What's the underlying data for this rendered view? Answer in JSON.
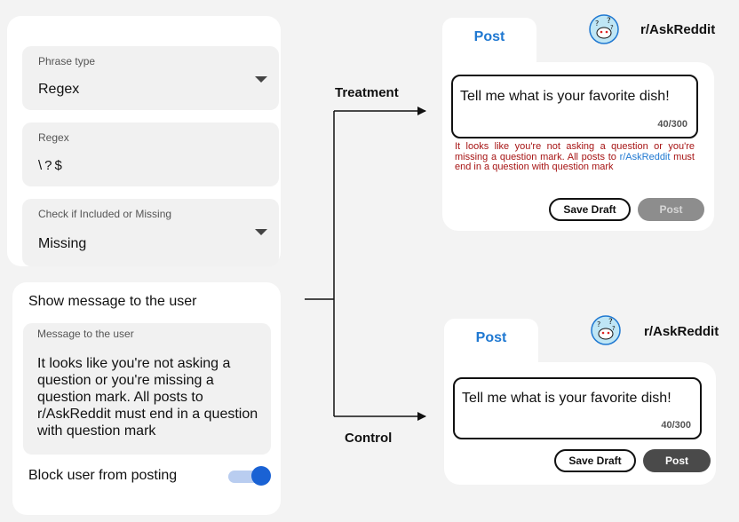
{
  "form": {
    "phrase_type": {
      "label": "Phrase type",
      "value": "Regex"
    },
    "regex": {
      "label": "Regex",
      "value": "\\?$"
    },
    "check": {
      "label": "Check if Included or Missing",
      "value": "Missing"
    }
  },
  "message_settings": {
    "show_label": "Show message to the user",
    "message_field_label": "Message to the user",
    "message": "It looks like you're not asking a question or you're missing a question mark. All posts to r/AskReddit must end in a question with question mark",
    "block_label": "Block user from posting",
    "block_enabled": true
  },
  "flow": {
    "treatment_label": "Treatment",
    "control_label": "Control"
  },
  "treatment": {
    "tab": "Post",
    "subreddit": "r/AskReddit",
    "text": "Tell me what is your favorite dish!",
    "counter": "40/300",
    "warning_prefix": "It looks like you're not asking a question or you're missing a question mark. All posts to ",
    "warning_link": "r/AskReddit",
    "warning_suffix": " must end in a question with question mark",
    "save_draft": "Save Draft",
    "post": "Post"
  },
  "control": {
    "tab": "Post",
    "subreddit": "r/AskReddit",
    "text": "Tell me what is your favorite dish!",
    "counter": "40/300",
    "save_draft": "Save Draft",
    "post": "Post"
  },
  "colors": {
    "accent": "#1f78d1",
    "warning": "#a61414",
    "toggle": "#1a62d4"
  }
}
